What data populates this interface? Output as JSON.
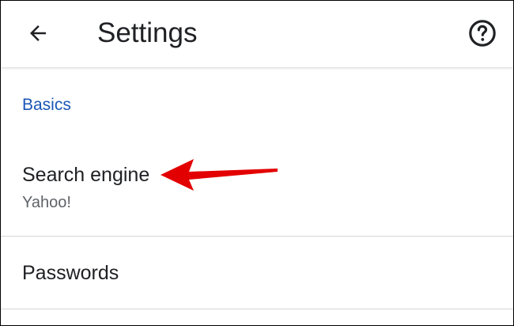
{
  "app_bar": {
    "title": "Settings",
    "back_icon": "arrow-left-icon",
    "help_icon": "help-circle-icon"
  },
  "basics": {
    "header": "Basics",
    "items": [
      {
        "title": "Search engine",
        "subtitle": "Yahoo!"
      },
      {
        "title": "Passwords"
      }
    ]
  },
  "colors": {
    "accent": "#1a56b7",
    "text_primary": "#202124",
    "text_secondary": "#5f6368",
    "divider": "#d5d5d5",
    "annotation": "#e30000"
  }
}
